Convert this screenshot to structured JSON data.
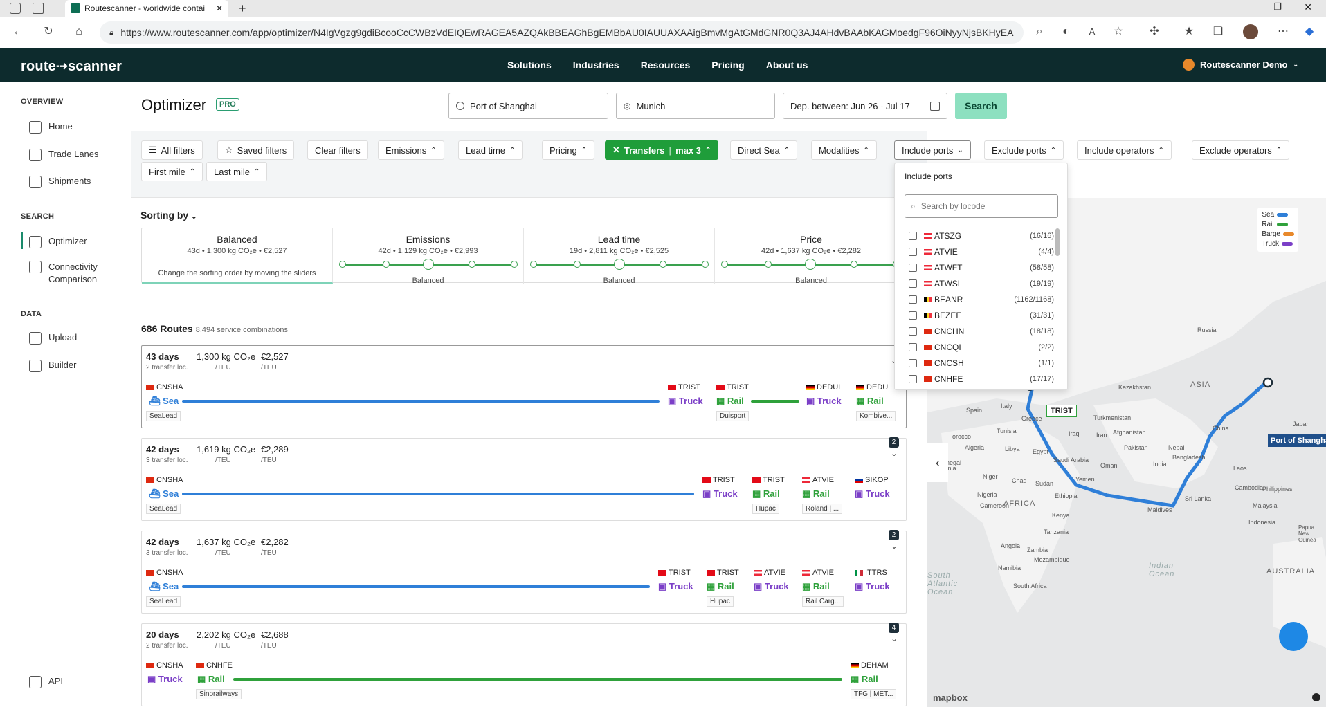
{
  "browser": {
    "tab_title": "Routescanner - worldwide contai",
    "url": "https://www.routescanner.com/app/optimizer/N4IgVgzg9gdiBcooCcCWBzVdEIQEwRAGEA5AZQAkBBEAGhBgEMBbAU0IAUUAXAAigBmvMgAtGMdGNR0Q3AJ4AHdvBAAbKAGMoedgF96OiNyyNjsBKHyEAIgF..."
  },
  "header": {
    "logo": "route⇢scanner",
    "nav": [
      "Solutions",
      "Industries",
      "Resources",
      "Pricing",
      "About us"
    ],
    "user": "Routescanner Demo"
  },
  "sidebar": {
    "overview_label": "OVERVIEW",
    "overview": [
      "Home",
      "Trade Lanes",
      "Shipments"
    ],
    "search_label": "SEARCH",
    "search_items": [
      "Optimizer",
      "Connectivity",
      "Comparison"
    ],
    "data_label": "DATA",
    "data": [
      "Upload",
      "Builder"
    ],
    "api": "API"
  },
  "main": {
    "title": "Optimizer",
    "pro": "PRO",
    "origin": "Port of Shanghai",
    "destination": "Munich",
    "dates": "Dep. between: Jun 26 - Jul 17",
    "search": "Search"
  },
  "filters": {
    "all": "All filters",
    "saved": "Saved filters",
    "clear": "Clear filters",
    "emissions": "Emissions",
    "lead_time": "Lead time",
    "pricing": "Pricing",
    "transfers": "Transfers",
    "transfers_val": "max 3",
    "direct_sea": "Direct Sea",
    "modalities": "Modalities",
    "include_ports": "Include ports",
    "exclude_ports": "Exclude ports",
    "include_operators": "Include operators",
    "exclude_operators": "Exclude operators",
    "first_mile": "First mile",
    "last_mile": "Last mile"
  },
  "sorting": {
    "label": "Sorting by",
    "columns": [
      {
        "title": "Balanced",
        "sub": "43d • 1,300 kg CO₂e • €2,527",
        "note": "Change the sorting order by moving the sliders"
      },
      {
        "title": "Emissions",
        "sub": "42d • 1,129 kg CO₂e • €2,993",
        "note": "Balanced"
      },
      {
        "title": "Lead time",
        "sub": "19d • 2,811 kg CO₂e • €2,525",
        "note": "Balanced"
      },
      {
        "title": "Price",
        "sub": "42d • 1,637 kg CO₂e • €2,282",
        "note": "Balanced"
      }
    ]
  },
  "routes": {
    "count": "686 Routes",
    "combos": "8,494 service combinations",
    "cards": [
      {
        "days": "43 days",
        "transfers": "2 transfer loc.",
        "co2": "1,300 kg CO₂e",
        "price": "€2,527",
        "per": "/TEU",
        "badge": "",
        "legs": [
          {
            "loc": "CNSHA",
            "mode": "Sea",
            "op": "SeaLead"
          },
          {
            "loc": "TRIST",
            "mode": "Truck",
            "op": ""
          },
          {
            "loc": "TRIST",
            "mode": "Rail",
            "op": "Duisport"
          },
          {
            "loc": "DEDUI",
            "mode": "Truck",
            "op": ""
          },
          {
            "loc": "DEDU",
            "mode": "Rail",
            "op": "Kombive..."
          }
        ]
      },
      {
        "days": "42 days",
        "transfers": "3 transfer loc.",
        "co2": "1,619 kg CO₂e",
        "price": "€2,289",
        "per": "/TEU",
        "badge": "2",
        "legs": [
          {
            "loc": "CNSHA",
            "mode": "Sea",
            "op": "SeaLead"
          },
          {
            "loc": "TRIST",
            "mode": "Truck",
            "op": ""
          },
          {
            "loc": "TRIST",
            "mode": "Rail",
            "op": "Hupac"
          },
          {
            "loc": "ATVIE",
            "mode": "Rail",
            "op": "Roland | ..."
          },
          {
            "loc": "SIKOP",
            "mode": "Truck",
            "op": ""
          }
        ]
      },
      {
        "days": "42 days",
        "transfers": "3 transfer loc.",
        "co2": "1,637 kg CO₂e",
        "price": "€2,282",
        "per": "/TEU",
        "badge": "2",
        "legs": [
          {
            "loc": "CNSHA",
            "mode": "Sea",
            "op": "SeaLead"
          },
          {
            "loc": "TRIST",
            "mode": "Truck",
            "op": ""
          },
          {
            "loc": "TRIST",
            "mode": "Rail",
            "op": "Hupac"
          },
          {
            "loc": "ATVIE",
            "mode": "Truck",
            "op": ""
          },
          {
            "loc": "ATVIE",
            "mode": "Rail",
            "op": "Rail Carg..."
          },
          {
            "loc": "ITTRS",
            "mode": "Truck",
            "op": ""
          }
        ]
      },
      {
        "days": "20 days",
        "transfers": "2 transfer loc.",
        "co2": "2,202 kg CO₂e",
        "price": "€2,688",
        "per": "/TEU",
        "badge": "4",
        "legs": [
          {
            "loc": "CNSHA",
            "mode": "Truck",
            "op": ""
          },
          {
            "loc": "CNHFE",
            "mode": "Rail",
            "op": "Sinorailways"
          },
          {
            "loc": "DEHAM",
            "mode": "Rail",
            "op": "TFG | MET..."
          }
        ]
      }
    ]
  },
  "include_ports_dd": {
    "title": "Include ports",
    "placeholder": "Search by locode",
    "items": [
      {
        "code": "ATSZG",
        "count": "(16/16)"
      },
      {
        "code": "ATVIE",
        "count": "(4/4)"
      },
      {
        "code": "ATWFT",
        "count": "(58/58)"
      },
      {
        "code": "ATWSL",
        "count": "(19/19)"
      },
      {
        "code": "BEANR",
        "count": "(1162/1168)"
      },
      {
        "code": "BEZEE",
        "count": "(31/31)"
      },
      {
        "code": "CNCHN",
        "count": "(18/18)"
      },
      {
        "code": "CNCQI",
        "count": "(2/2)"
      },
      {
        "code": "CNCSH",
        "count": "(1/1)"
      },
      {
        "code": "CNHFE",
        "count": "(17/17)"
      }
    ]
  },
  "map": {
    "legend": [
      "Sea",
      "Rail",
      "Barge",
      "Truck"
    ],
    "marker_trist": "TRIST",
    "marker_shanghai": "Port of Shanghai",
    "labels": [
      "Russia",
      "ASIA",
      "Kazakhstan",
      "China",
      "Japan",
      "Italy",
      "Spain",
      "Greece",
      "Turkmenistan",
      "Iraq",
      "Iran",
      "Afghanistan",
      "Pakistan",
      "Nepal",
      "Bangladesh",
      "India",
      "Tunisia",
      "Algeria",
      "Libya",
      "Egypt",
      "Saudi Arabia",
      "Oman",
      "Yemen",
      "Niger",
      "Chad",
      "Sudan",
      "Ethiopia",
      "Nigeria",
      "Cameroon",
      "AFRICA",
      "Kenya",
      "Tanzania",
      "Angola",
      "Zambia",
      "Mozambique",
      "Namibia",
      "South Africa",
      "Senegal",
      "Maldives",
      "Sri Lanka",
      "Laos",
      "Cambodia",
      "Philippines",
      "Indonesia",
      "AUSTRALIA",
      "Papua New Guinea",
      "Indian Ocean",
      "South Atlantic Ocean",
      "orocco",
      "tania",
      "Malaysia"
    ],
    "attribution": "mapbox"
  },
  "colors": {
    "sea": "#2f7fd8",
    "rail": "#2fa13b",
    "barge": "#e8892b",
    "truck": "#7b3fc7",
    "brand": "#0d2b2d"
  }
}
